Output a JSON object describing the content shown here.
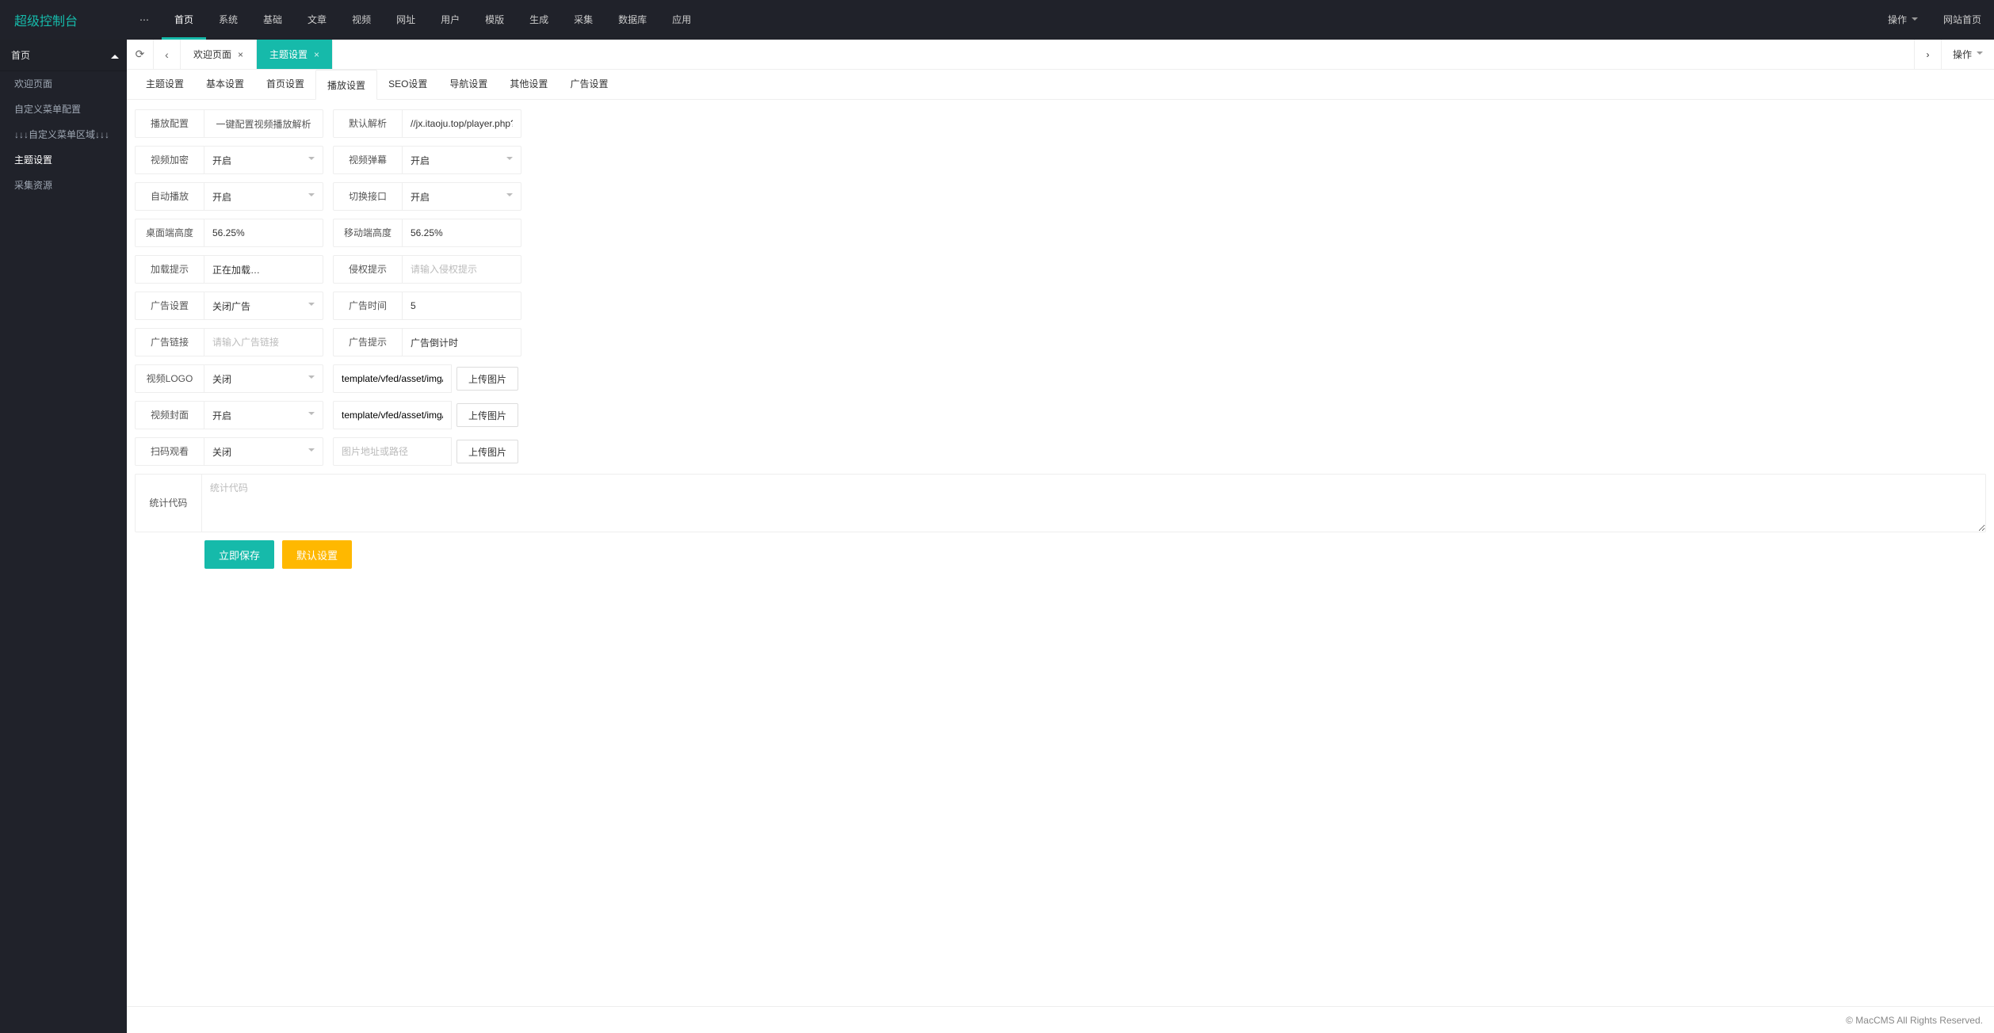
{
  "header": {
    "logo": "超级控制台",
    "nav": [
      {
        "label": "首页",
        "active": true
      },
      {
        "label": "系统",
        "active": false
      },
      {
        "label": "基础",
        "active": false
      },
      {
        "label": "文章",
        "active": false
      },
      {
        "label": "视频",
        "active": false
      },
      {
        "label": "网址",
        "active": false
      },
      {
        "label": "用户",
        "active": false
      },
      {
        "label": "模版",
        "active": false
      },
      {
        "label": "生成",
        "active": false
      },
      {
        "label": "采集",
        "active": false
      },
      {
        "label": "数据库",
        "active": false
      },
      {
        "label": "应用",
        "active": false
      }
    ],
    "ops_label": "操作",
    "site_home_label": "网站首页"
  },
  "sidebar": {
    "group": "首页",
    "items": [
      {
        "label": "欢迎页面",
        "active": false
      },
      {
        "label": "自定义菜单配置",
        "active": false
      },
      {
        "label": "↓↓↓自定义菜单区域↓↓↓",
        "active": false
      },
      {
        "label": "主题设置",
        "active": true
      },
      {
        "label": "采集资源",
        "active": false
      }
    ]
  },
  "tabs": {
    "list": [
      {
        "label": "欢迎页面",
        "active": false,
        "closable": true
      },
      {
        "label": "主题设置",
        "active": true,
        "closable": true
      }
    ],
    "ops_label": "操作"
  },
  "inner_tabs": [
    {
      "label": "主题设置",
      "active": false
    },
    {
      "label": "基本设置",
      "active": false
    },
    {
      "label": "首页设置",
      "active": false
    },
    {
      "label": "播放设置",
      "active": true
    },
    {
      "label": "SEO设置",
      "active": false
    },
    {
      "label": "导航设置",
      "active": false
    },
    {
      "label": "其他设置",
      "active": false
    },
    {
      "label": "广告设置",
      "active": false
    }
  ],
  "labels": {
    "play_config": "播放配置",
    "play_config_btn": "一键配置视频播放解析",
    "default_parse": "默认解析",
    "video_encrypt": "视频加密",
    "video_popup": "视频弹幕",
    "auto_play": "自动播放",
    "switch_interface": "切换接口",
    "desktop_height": "桌面端高度",
    "mobile_height": "移动端高度",
    "loading_tip": "加载提示",
    "infringe_tip": "侵权提示",
    "ad_setting": "广告设置",
    "ad_time": "广告时间",
    "ad_link": "广告链接",
    "ad_tip": "广告提示",
    "video_logo": "视频LOGO",
    "video_cover": "视频封面",
    "scan_watch": "扫码观看",
    "stat_code": "统计代码",
    "upload_img": "上传图片",
    "save": "立即保存",
    "reset": "默认设置"
  },
  "values": {
    "default_parse": "//jx.itaoju.top/player.php?url=",
    "video_encrypt": "开启",
    "video_popup": "开启",
    "auto_play": "开启",
    "switch_interface": "开启",
    "desktop_height": "56.25%",
    "mobile_height": "56.25%",
    "loading_tip": "正在加载…",
    "infringe_tip": "",
    "infringe_tip_ph": "请输入侵权提示",
    "ad_setting": "关闭广告",
    "ad_time": "5",
    "ad_link": "",
    "ad_link_ph": "请输入广告链接",
    "ad_tip": "广告倒计时",
    "video_logo": "关闭",
    "video_logo_path": "template/vfed/asset/img/logo",
    "video_cover": "开启",
    "video_cover_path": "template/vfed/asset/img/load",
    "scan_watch": "关闭",
    "scan_path": "",
    "scan_path_ph": "图片地址或路径",
    "stat_code": "",
    "stat_code_ph": "统计代码"
  },
  "footer": {
    "copyright": "© MacCMS All Rights Reserved."
  }
}
